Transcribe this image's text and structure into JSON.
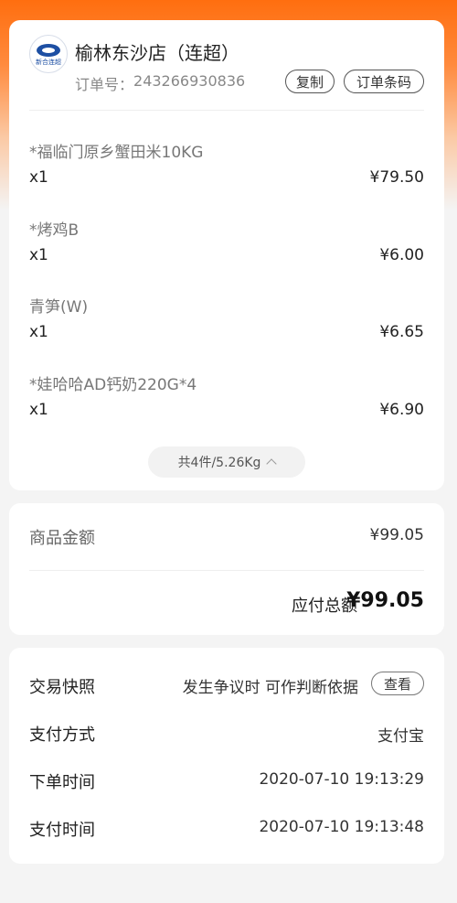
{
  "store": {
    "name": "榆林东沙店（连超）",
    "logo_text": "新合连超",
    "order_label": "订单号：",
    "order_number": "243266930836",
    "copy_label": "复制",
    "barcode_label": "订单条码"
  },
  "items": [
    {
      "name": "*福临门原乡蟹田米10KG",
      "qty": "x1",
      "price": "¥79.50"
    },
    {
      "name": "*烤鸡B",
      "qty": "x1",
      "price": "¥6.00"
    },
    {
      "name": "青笋(W)",
      "qty": "x1",
      "price": "¥6.65"
    },
    {
      "name": "*娃哈哈AD钙奶220G*4",
      "qty": "x1",
      "price": "¥6.90"
    }
  ],
  "items_summary": "共4件/5.26Kg",
  "amount": {
    "goods_label": "商品金额",
    "goods_value": "¥99.05",
    "due_label": "应付总额",
    "due_value": "¥99.05"
  },
  "info": {
    "snapshot_label": "交易快照",
    "snapshot_note": "发生争议时 可作判断依据",
    "view_label": "查看",
    "pay_method_label": "支付方式",
    "pay_method_value": "支付宝",
    "order_time_label": "下单时间",
    "order_time_value": "2020-07-10 19:13:29",
    "pay_time_label": "支付时间",
    "pay_time_value": "2020-07-10 19:13:48"
  },
  "colors": {
    "header_orange": "#ff6e0f",
    "logo_blue": "#1d4fa3"
  }
}
